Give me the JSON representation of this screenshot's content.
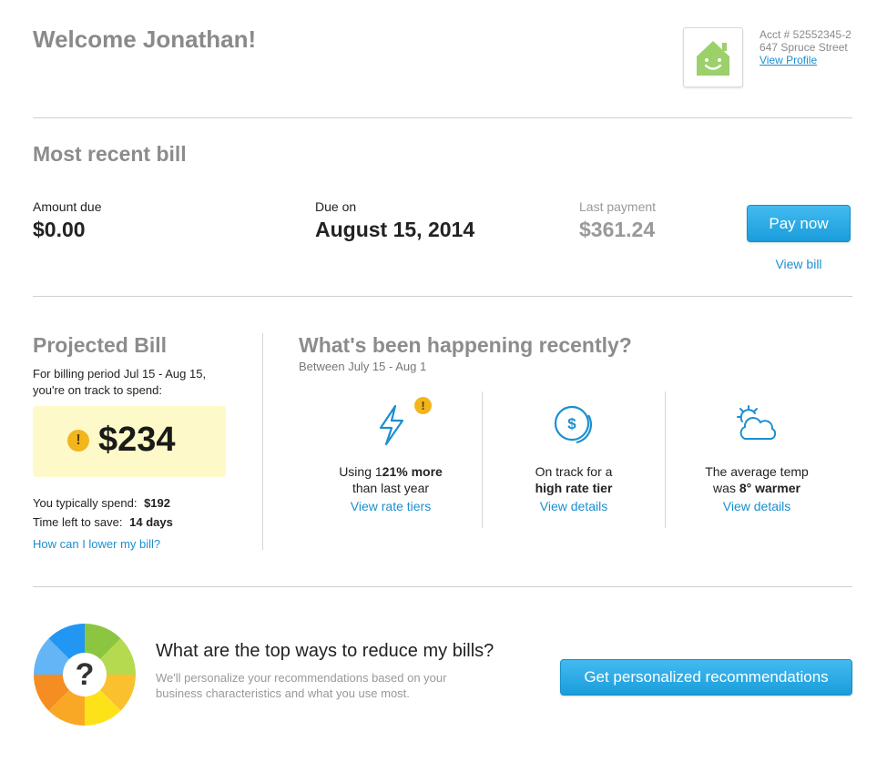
{
  "header": {
    "welcome": "Welcome Jonathan!",
    "account_number": "Acct # 52552345-2",
    "address": "647 Spruce Street",
    "view_profile": "View Profile"
  },
  "recent_bill": {
    "title": "Most recent bill",
    "amount_due_label": "Amount due",
    "amount_due_value": "$0.00",
    "due_on_label": "Due on",
    "due_on_value": "August 15, 2014",
    "last_payment_label": "Last payment",
    "last_payment_value": "$361.24",
    "pay_now": "Pay now",
    "view_bill": "View bill"
  },
  "projected": {
    "title": "Projected Bill",
    "period_line1": "For billing period Jul 15 - Aug 15,",
    "period_line2": "you're on track to spend:",
    "amount": "$234",
    "typical_label": "You typically spend:",
    "typical_value": "$192",
    "time_left_label": "Time left to save:",
    "time_left_value": "14 days",
    "lower_link": "How can I lower my bill?"
  },
  "happening": {
    "title": "What's been happening recently?",
    "subtitle": "Between July 15 - Aug 1",
    "items": [
      {
        "icon": "lightning-icon",
        "line1_pre": "Using 1",
        "line1_bold": "21% more",
        "line2": "than last year",
        "link": "View rate tiers"
      },
      {
        "icon": "dollar-coin-icon",
        "line1_pre": "On track for a",
        "line2_bold": "high rate tier",
        "link": "View details"
      },
      {
        "icon": "sun-cloud-icon",
        "line1_pre": "The average temp",
        "line2_pre": "was ",
        "line2_bold": "8° warmer",
        "link": "View details"
      }
    ]
  },
  "reduce": {
    "question": "What are the top ways to reduce my bills?",
    "desc_line1": "We'll personalize your recommendations based on your",
    "desc_line2": "business characteristics and what you use most.",
    "button": "Get personalized recommendations",
    "wheel_symbol": "?"
  },
  "colors": {
    "accent_blue": "#1b8fd0",
    "warning_bg": "#fef9c8",
    "warning_icon": "#f3b51c",
    "house_green": "#9bd06b"
  }
}
